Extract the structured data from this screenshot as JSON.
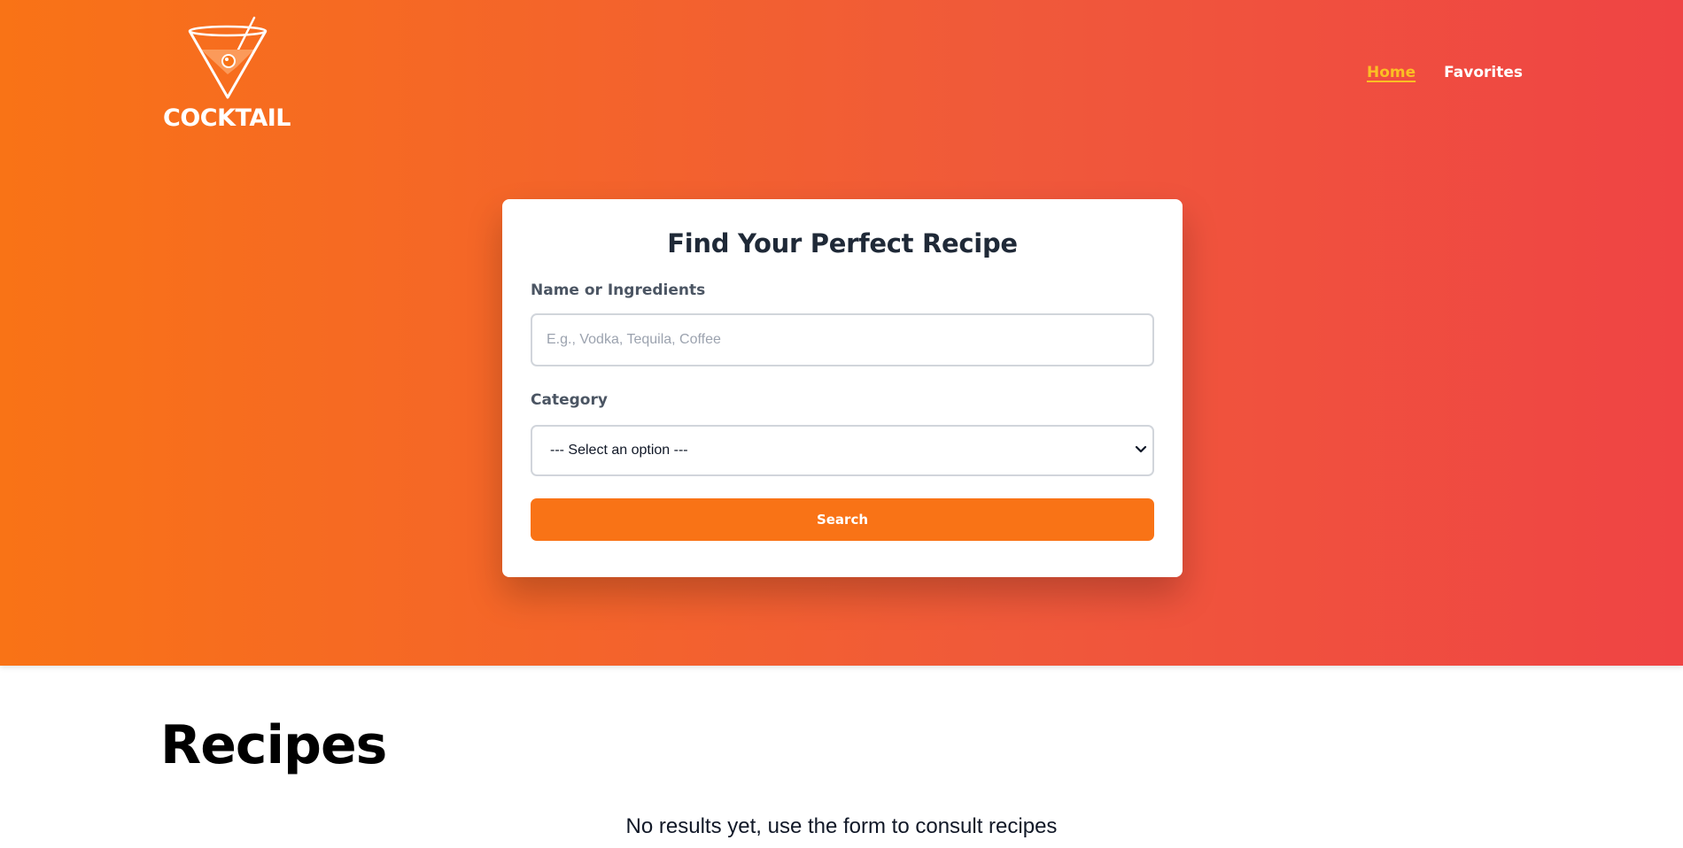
{
  "header": {
    "logo_text": "COCKTAIL",
    "nav": {
      "home": "Home",
      "favorites": "Favorites"
    }
  },
  "search_form": {
    "title": "Find Your Perfect Recipe",
    "name_label": "Name or Ingredients",
    "name_placeholder": "E.g., Vodka, Tequila, Coffee",
    "name_value": "",
    "category_label": "Category",
    "category_selected": "--- Select an option ---",
    "search_button": "Search"
  },
  "recipes": {
    "title": "Recipes",
    "empty_message": "No results yet, use the form to consult recipes"
  },
  "colors": {
    "gradient_start": "#f97316",
    "gradient_end": "#ef4444",
    "accent": "#f97316",
    "nav_active": "#fbbf24"
  },
  "icons": [
    "cocktail-glass-icon",
    "chevron-down-icon"
  ]
}
